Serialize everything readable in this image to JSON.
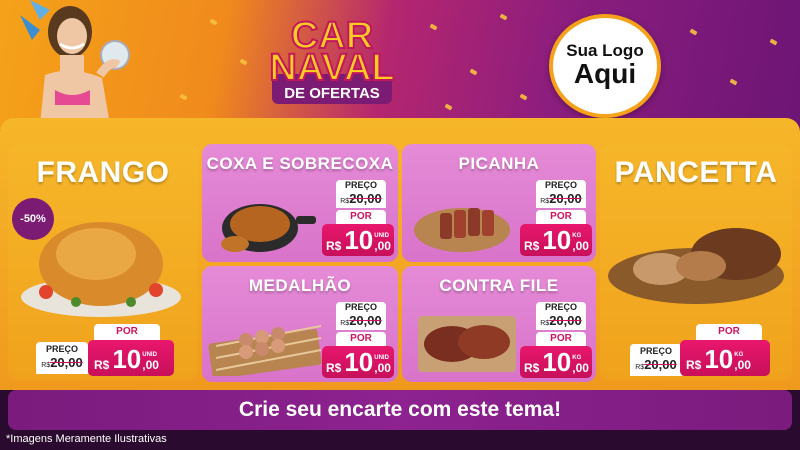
{
  "header": {
    "logo_lines": [
      "CAR",
      "NAVAL"
    ],
    "logo_sub": "DE OFERTAS",
    "store_logo": {
      "line1": "Sua Logo",
      "line2": "Aqui"
    }
  },
  "products": [
    {
      "name": "FRANGO",
      "discount": "-50%",
      "preco_label": "PREÇO",
      "old_price": "20,00",
      "currency": "R$",
      "por_label": "POR",
      "price_int": "10",
      "price_dec": ",00",
      "unit": "UNID"
    },
    {
      "name": "COXA E SOBRECOXA",
      "preco_label": "PREÇO",
      "old_price": "20,00",
      "currency": "R$",
      "por_label": "POR",
      "price_int": "10",
      "price_dec": ",00",
      "unit": "UNID"
    },
    {
      "name": "PICANHA",
      "preco_label": "PREÇO",
      "old_price": "20,00",
      "currency": "R$",
      "por_label": "POR",
      "price_int": "10",
      "price_dec": ",00",
      "unit": "KG"
    },
    {
      "name": "PANCETTA",
      "preco_label": "PREÇO",
      "old_price": "20,00",
      "currency": "R$",
      "por_label": "POR",
      "price_int": "10",
      "price_dec": ",00",
      "unit": "KG"
    },
    {
      "name": "MEDALHÃO",
      "preco_label": "PREÇO",
      "old_price": "20,00",
      "currency": "R$",
      "por_label": "POR",
      "price_int": "10",
      "price_dec": ",00",
      "unit": "UNID"
    },
    {
      "name": "CONTRA FILE",
      "preco_label": "PREÇO",
      "old_price": "20,00",
      "currency": "R$",
      "por_label": "POR",
      "price_int": "10",
      "price_dec": ",00",
      "unit": "KG"
    }
  ],
  "banner": "Crie seu encarte com este tema!",
  "disclaimer": "*Imagens Meramente Ilustrativas",
  "colors": {
    "pink_card": "#d873c9",
    "yellow": "#f6b62a",
    "price_red": "#d0115e",
    "purple": "#7a1b7d"
  }
}
